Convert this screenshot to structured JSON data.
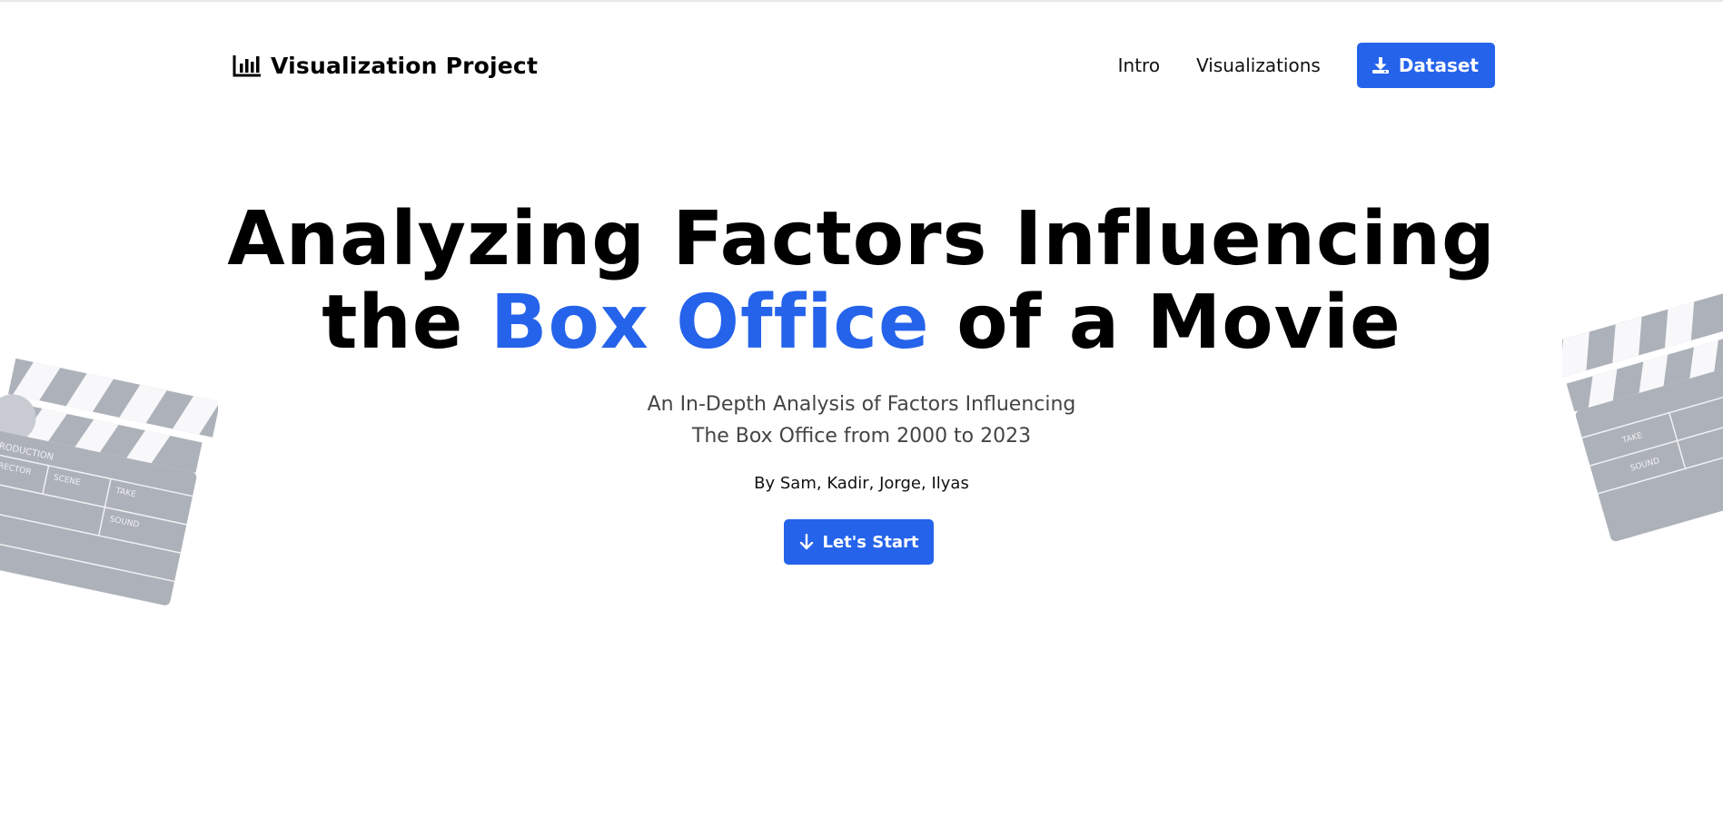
{
  "nav": {
    "brand": "Visualization Project",
    "brand_icon": "bar-chart-icon",
    "links": [
      "Intro",
      "Visualizations"
    ],
    "dataset_button": "Dataset",
    "dataset_icon": "download-icon"
  },
  "hero": {
    "title_line1": "Analyzing Factors Influencing",
    "title_pre": "the ",
    "title_accent": "Box Office",
    "title_post": " of a Movie",
    "subtitle_line1": "An In-Depth Analysis of Factors Influencing",
    "subtitle_line2": "The Box Office from 2000 to 2023",
    "byline": "By Sam, Kadir, Jorge, Ilyas",
    "cta": "Let's Start",
    "cta_icon": "arrow-down-icon"
  },
  "clapperboard_left": {
    "labels": [
      "PRODUCTION",
      "SCENE",
      "TAKE",
      "DIRECTOR",
      "SOUND"
    ]
  },
  "clapperboard_right": {
    "labels": [
      "TAKE",
      "SOUND"
    ]
  },
  "colors": {
    "accent": "#2563eb",
    "text": "#000000",
    "subtitle": "#444444",
    "clapperboard": "#9ca3af"
  }
}
